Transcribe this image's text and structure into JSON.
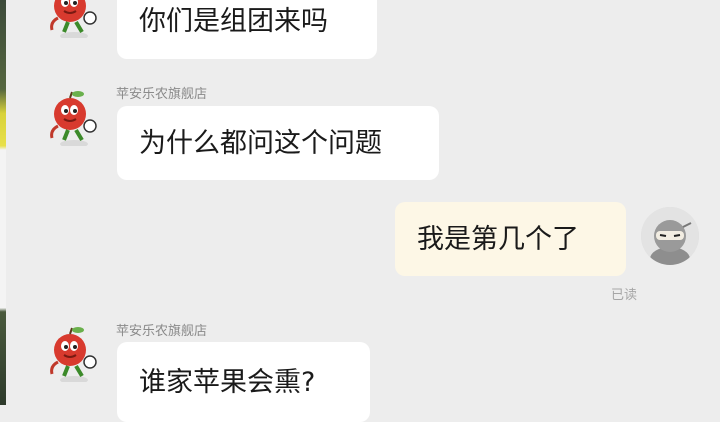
{
  "chat": {
    "messages": [
      {
        "sender": "",
        "text": "你们是组团来吗"
      },
      {
        "sender": "苹安乐农旗舰店",
        "text": "为什么都问这个问题"
      },
      {
        "sender": "",
        "text": "我是第几个了",
        "status": "已读"
      },
      {
        "sender": "苹安乐农旗舰店",
        "text": "谁家苹果会熏?"
      }
    ]
  },
  "icons": {
    "shop_avatar": "apple-mascot-icon",
    "user_avatar": "ninja-avatar-icon"
  },
  "colors": {
    "background": "#ededed",
    "bubble_incoming": "#ffffff",
    "bubble_outgoing": "#fdf7e6",
    "sender_name": "#8a8a8a"
  }
}
